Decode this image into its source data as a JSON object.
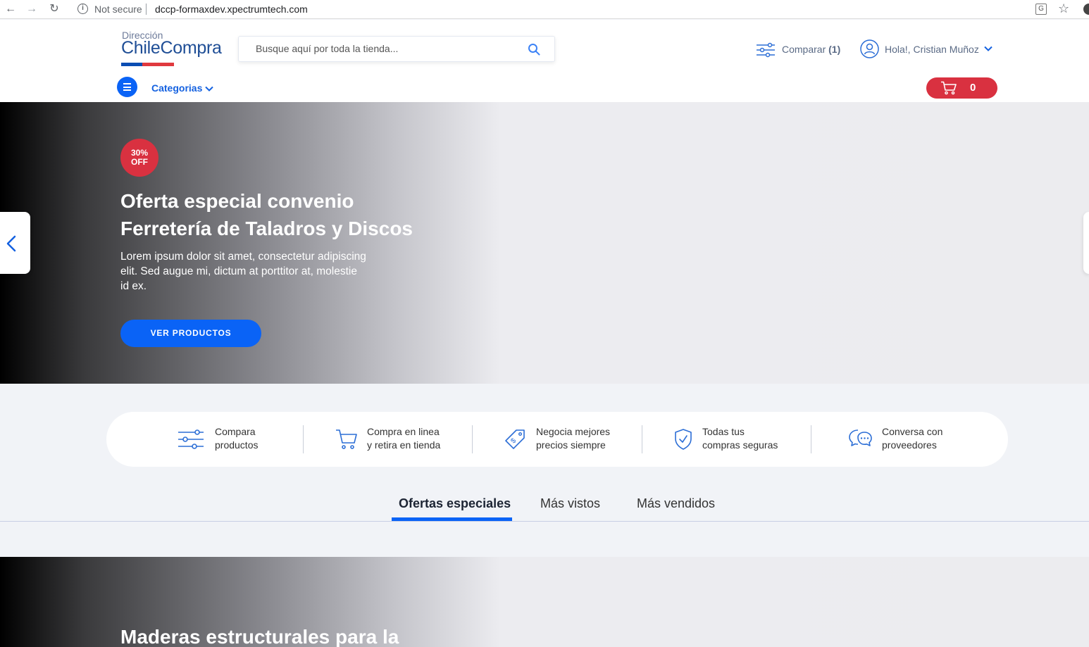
{
  "browser": {
    "security_label": "Not secure",
    "url": "dccp-formaxdev.xpectrumtech.com"
  },
  "header": {
    "logo_small": "Dirección",
    "logo_big": "ChileCompra",
    "search_placeholder": "Busque aquí por toda la tienda...",
    "compare_label": "Comparar",
    "compare_count": "(1)",
    "user_greeting": "Hola!, Cristian Muñoz",
    "categories_label": "Categorias",
    "cart_count": "0"
  },
  "hero": {
    "badge_line1": "30%",
    "badge_line2": "OFF",
    "title_line1": "Oferta especial convenio",
    "title_line2": "Ferretería de Taladros y Discos",
    "text": "Lorem ipsum dolor sit amet, consectetur adipiscing elit. Sed augue mi, dictum at porttitor at, molestie id ex.",
    "cta": "VER PRODUCTOS"
  },
  "features": [
    {
      "line1": "Compara",
      "line2": "productos",
      "icon": "compare-icon"
    },
    {
      "line1": "Compra en linea",
      "line2": "y retira en tienda",
      "icon": "cart-icon"
    },
    {
      "line1": "Negocia mejores",
      "line2": "precios siempre",
      "icon": "price-tag-icon"
    },
    {
      "line1": "Todas tus",
      "line2": "compras seguras",
      "icon": "shield-check-icon"
    },
    {
      "line1": "Conversa con",
      "line2": "proveedores",
      "icon": "chat-icon"
    }
  ],
  "tabs": [
    {
      "label": "Ofertas especiales",
      "active": true
    },
    {
      "label": "Más vistos",
      "active": false
    },
    {
      "label": "Más vendidos",
      "active": false
    }
  ],
  "hero2": {
    "title": "Maderas estructurales para la"
  },
  "colors": {
    "brand_blue": "#0a63f6",
    "brand_red": "#d93140",
    "text_muted": "#5a6a85"
  }
}
